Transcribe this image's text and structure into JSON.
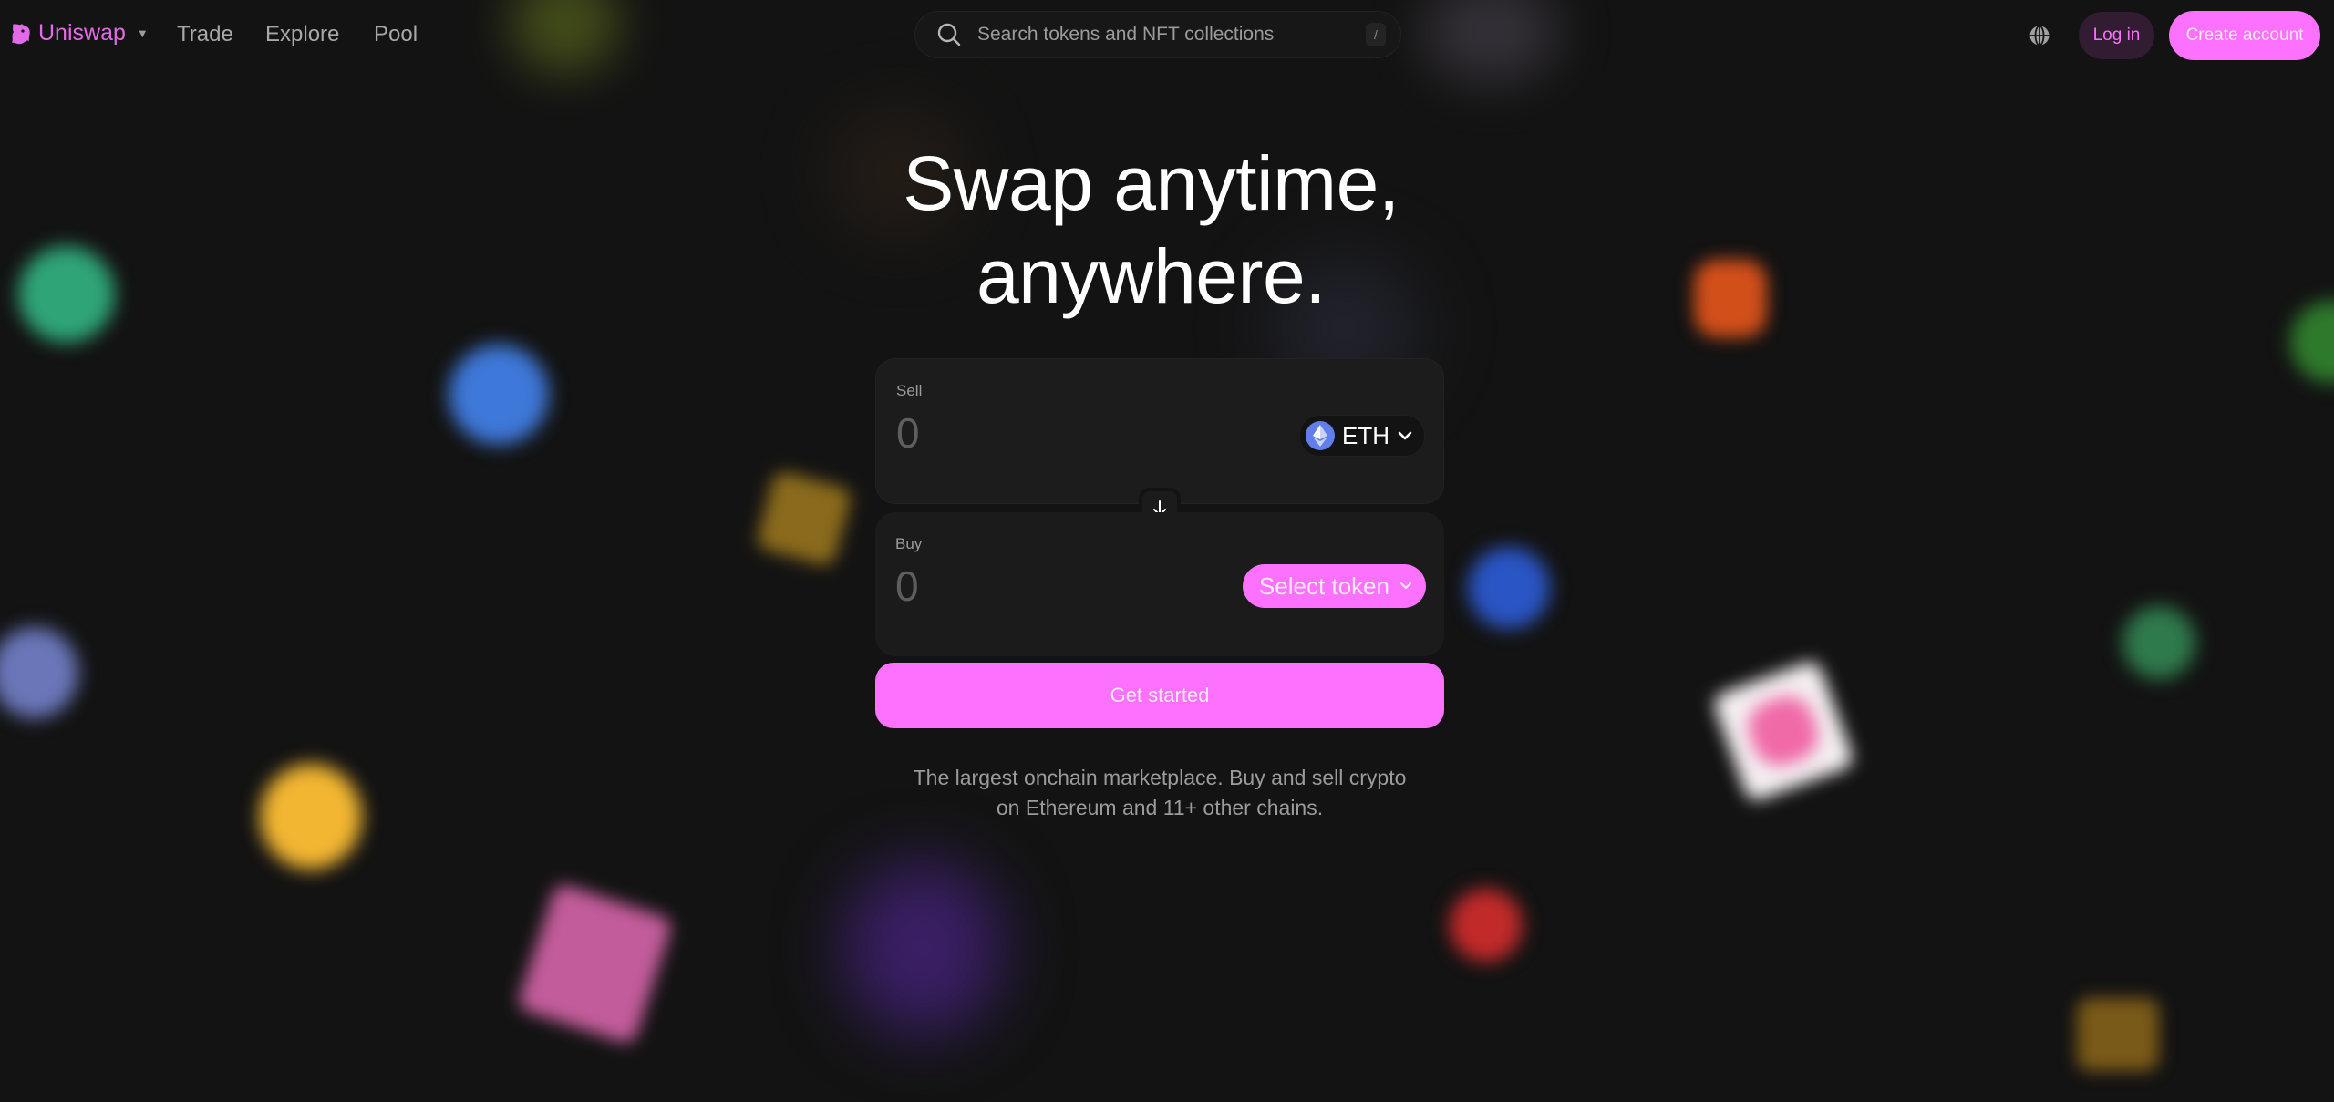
{
  "header": {
    "brand": "Uniswap",
    "nav": [
      {
        "label": "Trade"
      },
      {
        "label": "Explore"
      },
      {
        "label": "Pool"
      }
    ],
    "search": {
      "placeholder": "Search tokens and NFT collections",
      "value": "",
      "shortcut": "/"
    },
    "language_icon": "globe-icon",
    "login_label": "Log in",
    "create_account_label": "Create account"
  },
  "hero": {
    "title_line1": "Swap anytime,",
    "title_line2": "anywhere."
  },
  "swap": {
    "sell": {
      "label": "Sell",
      "amount_placeholder": "0",
      "amount_value": "",
      "token_symbol": "ETH",
      "token_icon": "eth-icon"
    },
    "switch_icon": "arrow-down-icon",
    "buy": {
      "label": "Buy",
      "amount_placeholder": "0",
      "amount_value": "",
      "select_label": "Select token"
    },
    "cta_label": "Get started"
  },
  "subtitle": {
    "line1": "The largest onchain marketplace. Buy and sell crypto",
    "line2": "on Ethereum and 11+ other chains."
  },
  "colors": {
    "background": "#131313",
    "accent": "#fc72ff",
    "accent_text": "#fde6fe",
    "card": "#1c1c1c",
    "muted_text": "#9b9b9b",
    "eth_blue": "#627eea"
  }
}
